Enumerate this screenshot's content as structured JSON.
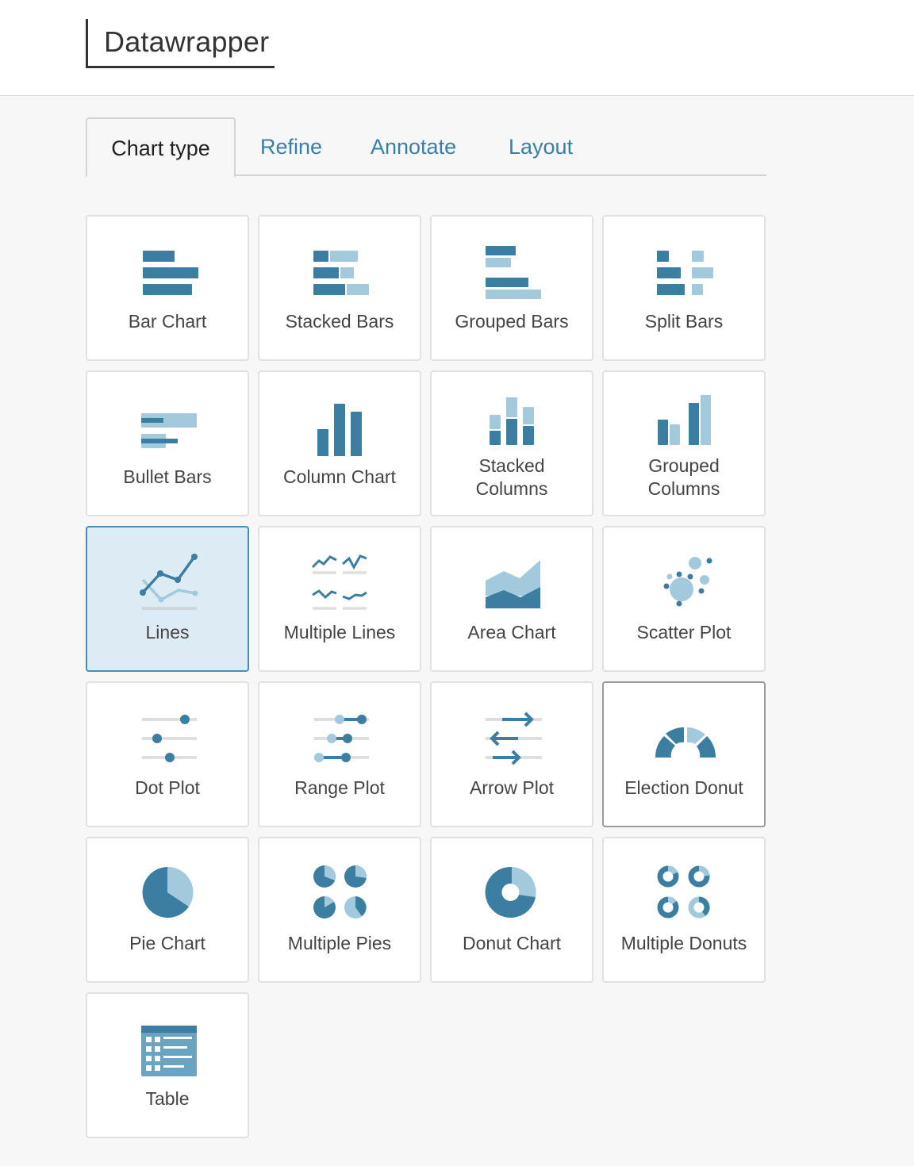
{
  "app": {
    "logo_text": "Datawrapper"
  },
  "tabs": [
    {
      "label": "Chart type",
      "active": true
    },
    {
      "label": "Refine",
      "active": false
    },
    {
      "label": "Annotate",
      "active": false
    },
    {
      "label": "Layout",
      "active": false
    }
  ],
  "colors": {
    "dark": "#3b7ea1",
    "light": "#a3cadc",
    "gray": "#dedede",
    "selected_bg": "#ddebf4",
    "tab_link": "#3a7fa6"
  },
  "chart_types": [
    {
      "label": "Bar Chart",
      "icon": "bar-chart-icon"
    },
    {
      "label": "Stacked Bars",
      "icon": "stacked-bars-icon"
    },
    {
      "label": "Grouped Bars",
      "icon": "grouped-bars-icon"
    },
    {
      "label": "Split Bars",
      "icon": "split-bars-icon"
    },
    {
      "label": "Bullet Bars",
      "icon": "bullet-bars-icon"
    },
    {
      "label": "Column Chart",
      "icon": "column-chart-icon"
    },
    {
      "label": "Stacked Columns",
      "icon": "stacked-columns-icon"
    },
    {
      "label": "Grouped Columns",
      "icon": "grouped-columns-icon"
    },
    {
      "label": "Lines",
      "icon": "lines-icon",
      "selected": true
    },
    {
      "label": "Multiple Lines",
      "icon": "multiple-lines-icon"
    },
    {
      "label": "Area Chart",
      "icon": "area-chart-icon"
    },
    {
      "label": "Scatter Plot",
      "icon": "scatter-plot-icon"
    },
    {
      "label": "Dot Plot",
      "icon": "dot-plot-icon"
    },
    {
      "label": "Range Plot",
      "icon": "range-plot-icon"
    },
    {
      "label": "Arrow Plot",
      "icon": "arrow-plot-icon"
    },
    {
      "label": "Election Donut",
      "icon": "election-donut-icon",
      "hovered": true
    },
    {
      "label": "Pie Chart",
      "icon": "pie-chart-icon"
    },
    {
      "label": "Multiple Pies",
      "icon": "multiple-pies-icon"
    },
    {
      "label": "Donut Chart",
      "icon": "donut-chart-icon"
    },
    {
      "label": "Multiple Donuts",
      "icon": "multiple-donuts-icon"
    },
    {
      "label": "Table",
      "icon": "table-icon"
    }
  ]
}
